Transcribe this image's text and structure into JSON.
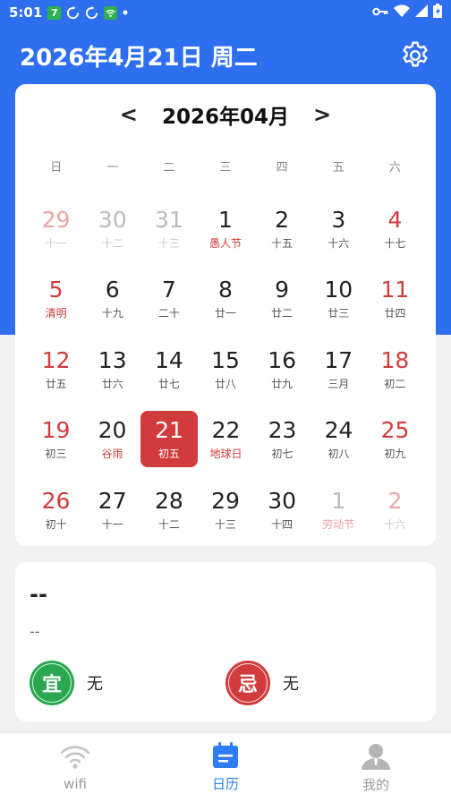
{
  "status_bar": {
    "time": "5:01",
    "badge": "7"
  },
  "header": {
    "date_title": "2026年4月21日 周二"
  },
  "calendar": {
    "month_title": "2026年04月",
    "prev": "<",
    "next": ">",
    "weekdays": [
      "日",
      "一",
      "二",
      "三",
      "四",
      "五",
      "六"
    ],
    "weeks": [
      [
        {
          "n": "29",
          "l": "十一",
          "other": true
        },
        {
          "n": "30",
          "l": "十二",
          "other": true
        },
        {
          "n": "31",
          "l": "十三",
          "other": true
        },
        {
          "n": "1",
          "l": "愚人节",
          "fest": true
        },
        {
          "n": "2",
          "l": "十五"
        },
        {
          "n": "3",
          "l": "十六"
        },
        {
          "n": "4",
          "l": "十七"
        }
      ],
      [
        {
          "n": "5",
          "l": "清明",
          "fest": true
        },
        {
          "n": "6",
          "l": "十九"
        },
        {
          "n": "7",
          "l": "二十"
        },
        {
          "n": "8",
          "l": "廿一"
        },
        {
          "n": "9",
          "l": "廿二"
        },
        {
          "n": "10",
          "l": "廿三"
        },
        {
          "n": "11",
          "l": "廿四"
        }
      ],
      [
        {
          "n": "12",
          "l": "廿五"
        },
        {
          "n": "13",
          "l": "廿六"
        },
        {
          "n": "14",
          "l": "廿七"
        },
        {
          "n": "15",
          "l": "廿八"
        },
        {
          "n": "16",
          "l": "廿九"
        },
        {
          "n": "17",
          "l": "三月"
        },
        {
          "n": "18",
          "l": "初二"
        }
      ],
      [
        {
          "n": "19",
          "l": "初三"
        },
        {
          "n": "20",
          "l": "谷雨",
          "fest": true
        },
        {
          "n": "21",
          "l": "初五",
          "selected": true
        },
        {
          "n": "22",
          "l": "地球日",
          "fest": true
        },
        {
          "n": "23",
          "l": "初七"
        },
        {
          "n": "24",
          "l": "初八"
        },
        {
          "n": "25",
          "l": "初九"
        }
      ],
      [
        {
          "n": "26",
          "l": "初十"
        },
        {
          "n": "27",
          "l": "十一"
        },
        {
          "n": "28",
          "l": "十二"
        },
        {
          "n": "29",
          "l": "十三"
        },
        {
          "n": "30",
          "l": "十四"
        },
        {
          "n": "1",
          "l": "劳动节",
          "other": true,
          "fest": true
        },
        {
          "n": "2",
          "l": "十六",
          "other": true
        }
      ]
    ]
  },
  "info": {
    "title": "--",
    "subtitle": "--",
    "yi_label": "宜",
    "yi_value": "无",
    "ji_label": "忌",
    "ji_value": "无"
  },
  "bottom_nav": [
    {
      "label": "wifi",
      "icon": "wifi-icon",
      "active": false
    },
    {
      "label": "日历",
      "icon": "calendar-icon",
      "active": true
    },
    {
      "label": "我的",
      "icon": "person-icon",
      "active": false
    }
  ],
  "colors": {
    "primary": "#2e6ff0",
    "weekend_red": "#d23b3b",
    "yi_green": "#2aa84f",
    "nav_active": "#2e7cf6"
  }
}
